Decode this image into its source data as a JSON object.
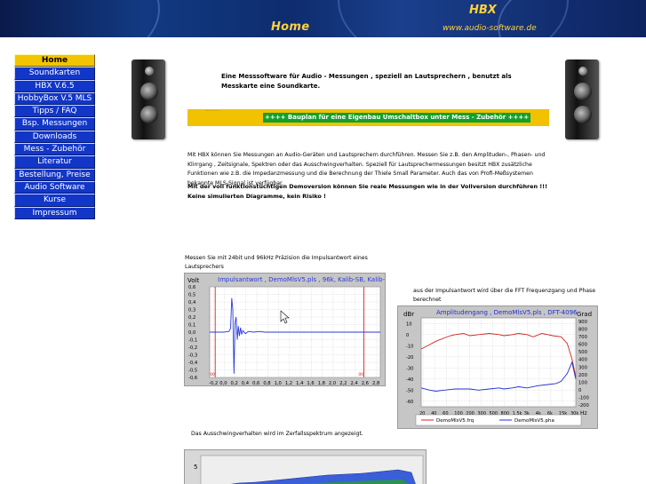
{
  "header": {
    "page_title": "Home",
    "brand": "HBX",
    "url": "www.audio-software.de"
  },
  "nav": {
    "items": [
      {
        "label": "Home",
        "active": true
      },
      {
        "label": "Soundkarten"
      },
      {
        "label": "HBX V.6.5"
      },
      {
        "label": "HobbyBox V.5 MLS"
      },
      {
        "label": "Tipps / FAQ"
      },
      {
        "label": "Bsp. Messungen"
      },
      {
        "label": "Downloads"
      },
      {
        "label": "Mess - Zubehör"
      },
      {
        "label": "Literatur"
      },
      {
        "label": "Bestellung, Preise"
      },
      {
        "label": "Audio Software"
      },
      {
        "label": "Kurse"
      },
      {
        "label": "Impressum"
      }
    ]
  },
  "content": {
    "intro": "Eine Messsoftware für Audio - Messungen , speziell an Lautsprechern , benutzt als Messkarte eine Soundkarte.",
    "link_bar_note": "... ... ...",
    "bauplan_link": "++++ Bauplan für eine Eigenbau Umschaltbox unter Mess - Zubehör ++++",
    "para1": "Mit HBX können Sie Messungen an Audio-Geräten und Lautsprechern durchführen. Messen Sie z.B. den Amplituden-, Phasen- und Klirrgang , Zeitsignale, Spektren oder das Ausschwingverhalten. Speziell für Lautsprechermessungen besitzt HBX zusätzliche Funktionen wie z.B. die Impedanzmessung und die Berechnung der Thiele Small Parameter. Auch das von Profi-Meßsystemen bekannte MLS-Signal ist verfügbar.",
    "para2": "Mit der voll funktionstüchtigen Demoversion können Sie reale Messungen wie in der Vollversion durchführen !!! Keine simulierten Diagramme, kein Risiko !",
    "caption_impulse": "Messen Sie mit 24bit und 96kHz Präzision die Impulsantwort eines Lautsprechers",
    "caption_fft": "aus der Impulsantwort wird über die FFT Frequenzgang und Phase berechnet",
    "caption_spectrum": "Das Ausschwingverhalten wird im Zerfallsspektrum angezeigt."
  },
  "chart_data": [
    {
      "type": "line",
      "title": "Impulsantwort , DemoMlsV5.pls , 96k, Kalib-SB, Kalib-",
      "ylabel": "Volt",
      "xlim": [
        -0.2,
        2.9
      ],
      "ylim": [
        -0.6,
        0.6
      ],
      "x_ticks": [
        "-0,2",
        "0,0",
        "0,2",
        "0,4",
        "0,6",
        "0,8",
        "1,0",
        "1,2",
        "1,4",
        "1,6",
        "1,8",
        "2,0",
        "2,2",
        "2,4",
        "2,6",
        "2,8"
      ],
      "y_ticks": [
        "0,6",
        "0,5",
        "0,4",
        "0,3",
        "0,2",
        "0,1",
        "0,0",
        "-0,1",
        "-0,2",
        "-0,3",
        "-0,4",
        "-0,5",
        "-0,6"
      ],
      "markers_x": [
        -0.1,
        2.6
      ],
      "marker_labels": [
        "00",
        "00"
      ],
      "series": [
        {
          "color": "#2a3adf",
          "x": [
            -0.2,
            0.05,
            0.15,
            0.18,
            0.2,
            0.22,
            0.24,
            0.26,
            0.28,
            0.3,
            0.32,
            0.34,
            0.36,
            0.38,
            0.4,
            0.45,
            0.5,
            0.6,
            0.7,
            0.8,
            1.0,
            1.4,
            2.0,
            2.6,
            2.9
          ],
          "y": [
            0.0,
            0.0,
            0.01,
            0.05,
            0.45,
            0.3,
            -0.55,
            0.12,
            0.2,
            -0.1,
            0.08,
            -0.05,
            0.06,
            -0.03,
            0.02,
            -0.02,
            0.01,
            0.0,
            0.01,
            0.0,
            0.0,
            0.0,
            0.0,
            0.0,
            0.0
          ]
        }
      ]
    },
    {
      "type": "line",
      "title": "Amplitudengang , DemoMlsV5.pls , DFT-4096",
      "ylabel": "dBr",
      "y2label": "Grad",
      "xlabel": "Hz",
      "x_scale": "log",
      "xlim": [
        20,
        30000
      ],
      "ylim": [
        -65,
        15
      ],
      "y2lim": [
        -200,
        1000
      ],
      "x_ticks": [
        "20",
        "40",
        "60",
        "100",
        "200",
        "300",
        "500",
        "800",
        "1,5k",
        "3k",
        "4k",
        "6k",
        "15k",
        "30k"
      ],
      "y_ticks": [
        "10",
        "0",
        "-10",
        "-20",
        "-30",
        "-40",
        "-50",
        "-60"
      ],
      "y2_ticks": [
        "900",
        "800",
        "700",
        "600",
        "500",
        "400",
        "300",
        "200",
        "100",
        "0",
        "-100",
        "-200"
      ],
      "legend": "bottom",
      "series": [
        {
          "name": "DemoMlsV5.frq",
          "color": "#d42020",
          "x": [
            20,
            30,
            40,
            60,
            80,
            100,
            150,
            200,
            300,
            500,
            800,
            1000,
            1500,
            2000,
            3000,
            4000,
            6000,
            8000,
            10000,
            15000,
            20000,
            25000,
            30000
          ],
          "y": [
            -13,
            -9,
            -6,
            -3,
            -1,
            0,
            1,
            -1,
            0,
            1,
            0,
            -1,
            0,
            1,
            0,
            -2,
            1,
            0,
            -1,
            -2,
            -8,
            -22,
            -38
          ]
        },
        {
          "name": "DemoMlsV5.pha",
          "color": "#2030d0",
          "x": [
            20,
            30,
            40,
            60,
            100,
            200,
            300,
            500,
            800,
            1000,
            1500,
            2000,
            3000,
            5000,
            8000,
            12000,
            15000,
            20000,
            25000,
            30000
          ],
          "y": [
            -48,
            -50,
            -51,
            -50,
            -49,
            -49,
            -50,
            -49,
            -48,
            -49,
            -48,
            -47,
            -48,
            -46,
            -45,
            -44,
            -42,
            -35,
            -25,
            -40
          ]
        }
      ]
    },
    {
      "type": "area",
      "ylabel": "",
      "y_ticks": [
        "5"
      ]
    }
  ]
}
